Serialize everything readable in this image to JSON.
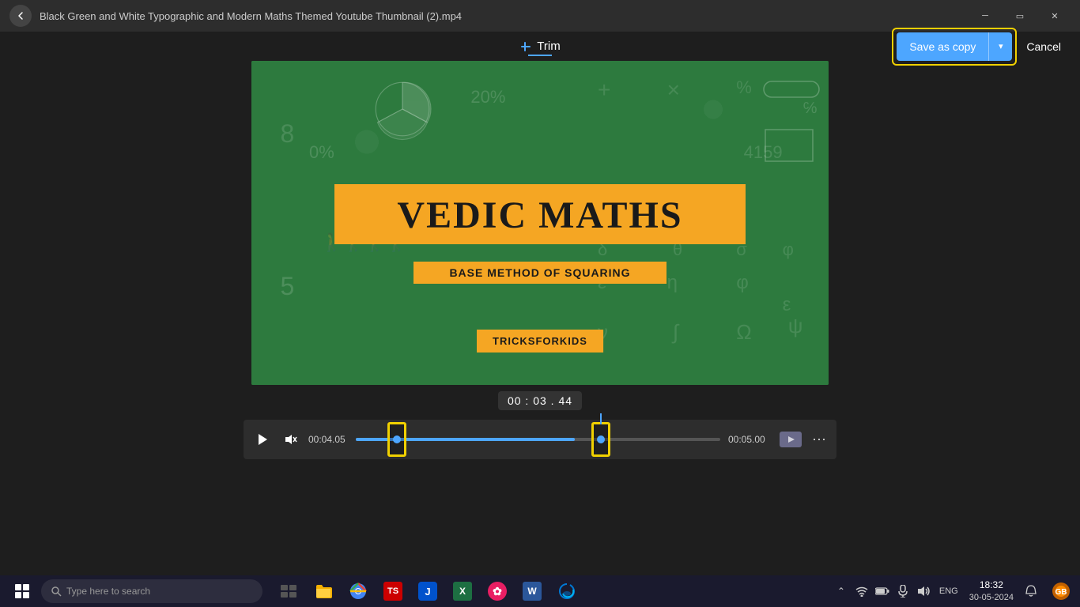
{
  "window": {
    "title": "Black Green and White Typographic and Modern Maths Themed Youtube Thumbnail (2).mp4",
    "back_label": "←"
  },
  "toolbar": {
    "trim_label": "Trim",
    "save_copy_label": "Save as copy",
    "cancel_label": "Cancel",
    "dropdown_label": "▾"
  },
  "video": {
    "title": "VEDIC MATHS",
    "subtitle": "BASE METHOD OF SQUARING",
    "brand": "TRICKSFORKIDS"
  },
  "time_display": {
    "value": "00 : 03 . 44"
  },
  "player": {
    "time_left": "00:04.05",
    "time_right": "00:05.00"
  },
  "taskbar": {
    "search_placeholder": "Type here to search",
    "clock_time": "18:32",
    "clock_date": "30-05-2024",
    "lang": "ENG",
    "apps": [
      {
        "name": "task-view",
        "color": "#555",
        "icon": "⊞"
      },
      {
        "name": "explorer",
        "color": "#f5b000",
        "icon": "📁"
      },
      {
        "name": "chrome",
        "color": "#e8453c",
        "icon": "◉"
      },
      {
        "name": "app1",
        "color": "#c00",
        "icon": "TS"
      },
      {
        "name": "jira",
        "color": "#0052cc",
        "icon": "J"
      },
      {
        "name": "excel",
        "color": "#1d6f42",
        "icon": "X"
      },
      {
        "name": "app2",
        "color": "#e91e63",
        "icon": "✿"
      },
      {
        "name": "word",
        "color": "#2b579a",
        "icon": "W"
      },
      {
        "name": "edge-app",
        "color": "#0078d4",
        "icon": "⊛"
      }
    ]
  }
}
